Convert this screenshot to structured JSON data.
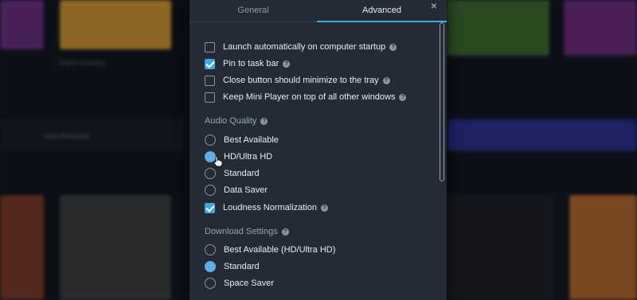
{
  "background": {
    "labels": [
      "Fresh Country",
      "New Releases"
    ]
  },
  "dialog": {
    "tabs": [
      {
        "label": "General",
        "active": false
      },
      {
        "label": "Advanced",
        "active": true
      }
    ],
    "close_glyph": "×",
    "accent_color": "#2fb6d6",
    "help_glyph": "?",
    "general_options": [
      {
        "label": "Launch automatically on computer startup",
        "checked": false
      },
      {
        "label": "Pin to task bar",
        "checked": true
      },
      {
        "label": "Close button should minimize to the tray",
        "checked": false
      },
      {
        "label": "Keep Mini Player on top of all other windows",
        "checked": false
      }
    ],
    "audio_quality": {
      "heading": "Audio Quality",
      "options": [
        {
          "label": "Best Available",
          "selected": false
        },
        {
          "label": "HD/Ultra HD",
          "selected": true
        },
        {
          "label": "Standard",
          "selected": false
        },
        {
          "label": "Data Saver",
          "selected": false
        }
      ],
      "loudness": {
        "label": "Loudness Normalization",
        "checked": true
      }
    },
    "download_settings": {
      "heading": "Download Settings",
      "options": [
        {
          "label": "Best Available (HD/Ultra HD)",
          "selected": false
        },
        {
          "label": "Standard",
          "selected": true
        },
        {
          "label": "Space Saver",
          "selected": false
        }
      ]
    }
  }
}
